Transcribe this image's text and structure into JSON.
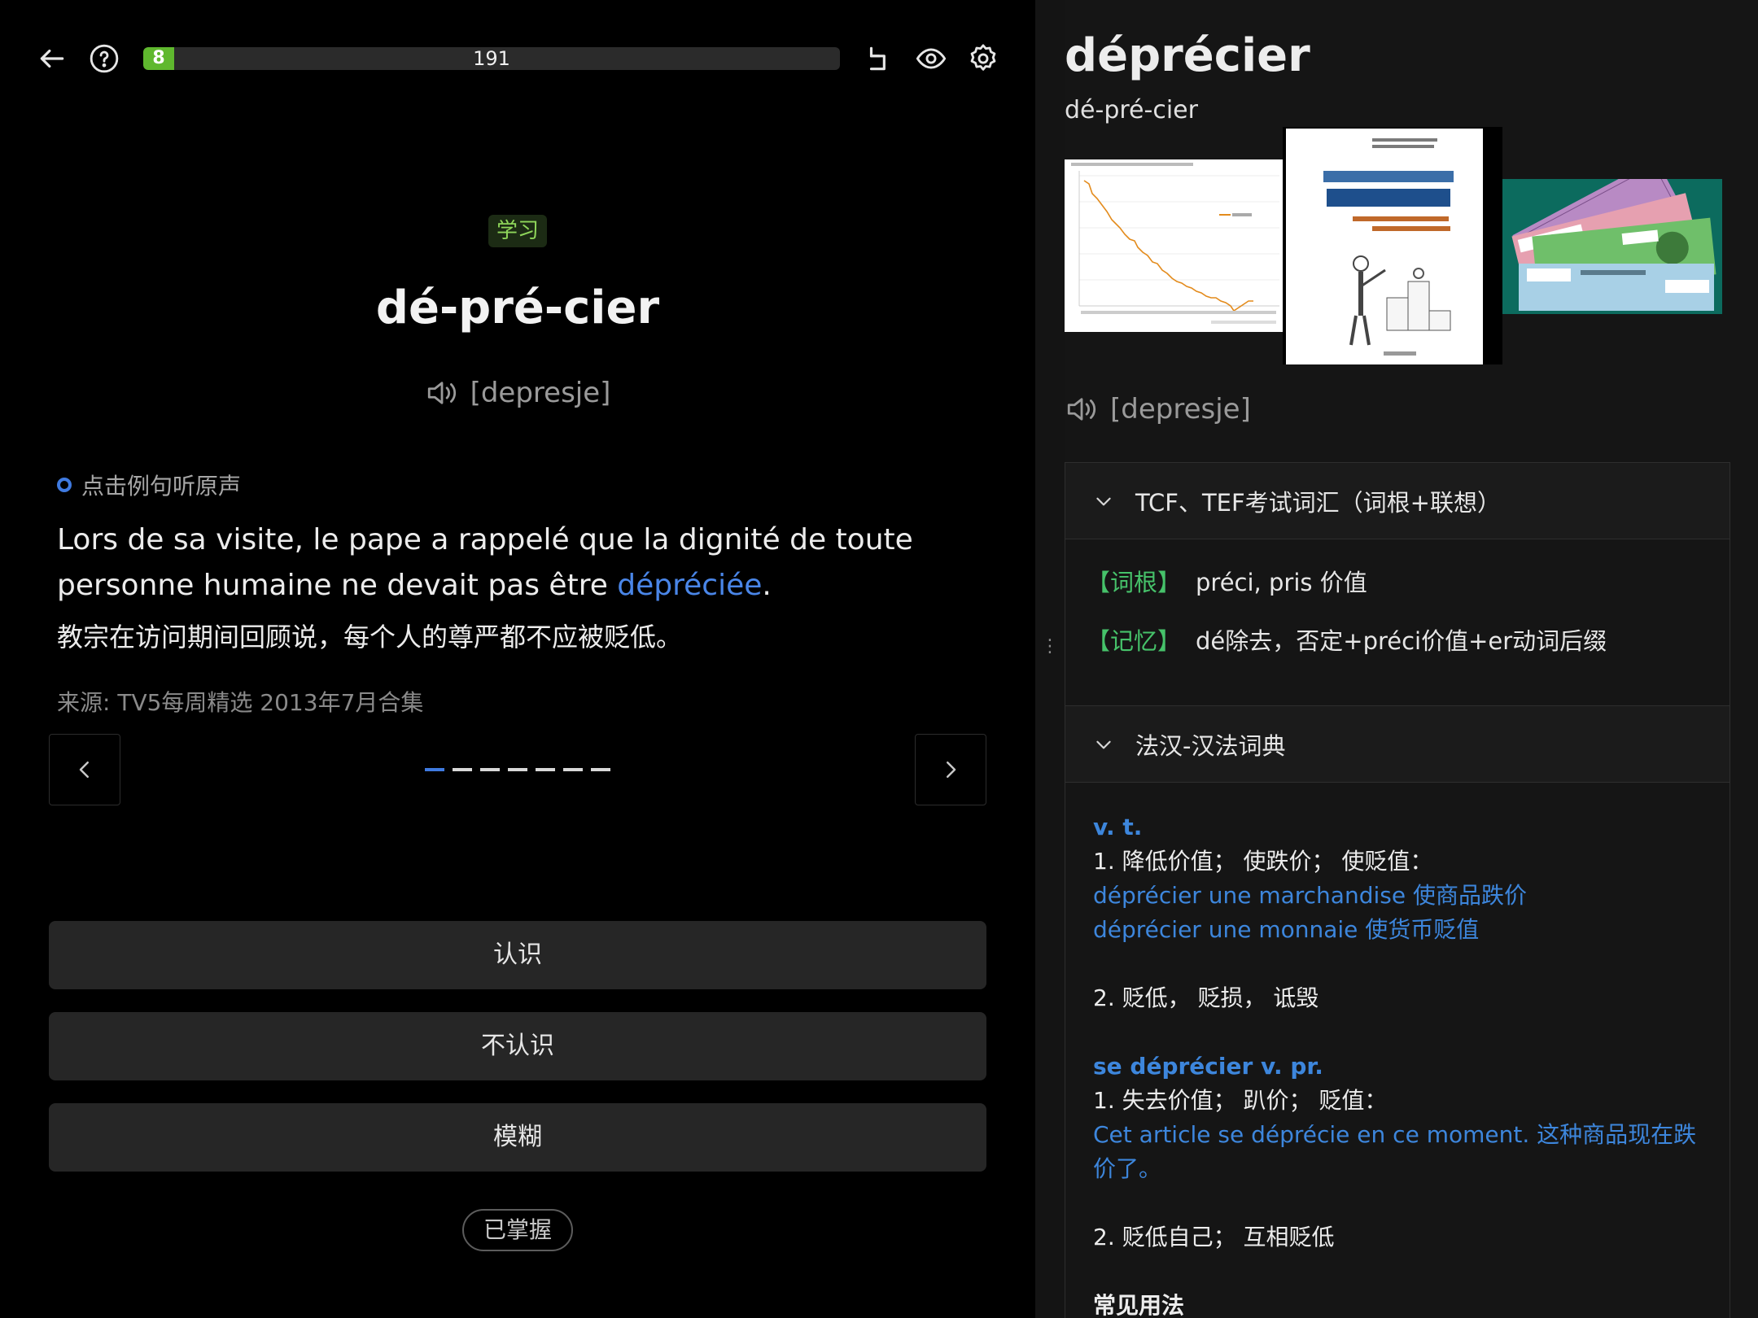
{
  "toolbar": {
    "progress_done": "8",
    "progress_total": "191",
    "progress_fraction": 0.044
  },
  "card": {
    "mode_badge": "学习",
    "syllables": "dé-pré-cier",
    "phonetic": "[depresje]",
    "hint": "点击例句听原声",
    "example_fr_before": "Lors de sa visite, le pape a rappelé que la dignité de toute personne humaine ne devait pas être ",
    "example_fr_highlight": "dépréciée",
    "example_fr_after": ".",
    "example_zh": "教宗在访问期间回顾说，每个人的尊严都不应被贬低。",
    "source": "来源: TV5每周精选 2013年7月合集",
    "pager_total": 7,
    "pager_active": 1
  },
  "answers": {
    "know": "认识",
    "dont_know": "不认识",
    "vague": "模糊",
    "mastered": "已掌握"
  },
  "detail": {
    "headword": "déprécier",
    "syllables": "dé-pré-cier",
    "phonetic": "[depresje]",
    "section1": {
      "title": "TCF、TEF考试词汇（词根+联想）",
      "root_tag": "【词根】",
      "root_text": "préci, pris 价值",
      "memo_tag": "【记忆】",
      "memo_text": "dé除去，否定+préci价值+er动词后缀"
    },
    "section2": {
      "title": "法汉-汉法词典",
      "pos1": "v. t.",
      "sense1": "1. 降低价值； 使跌价； 使贬值：",
      "ex1": "déprécier une marchandise 使商品跌价",
      "ex2": "déprécier une monnaie 使货币贬值",
      "sense2": "2. 贬低， 贬损， 诋毁",
      "pos2": "se déprécier v. pr.",
      "sense3": "1. 失去价值； 趴价； 贬值：",
      "ex3": "Cet article se déprécie en ce moment. 这种商品现在跌价了。",
      "sense4": "2. 贬低自己； 互相贬低",
      "usage_title": "常见用法"
    }
  },
  "colors": {
    "accent_blue": "#3f7ae0",
    "progress_green": "#5fb82e",
    "tag_green": "#46c26a"
  }
}
